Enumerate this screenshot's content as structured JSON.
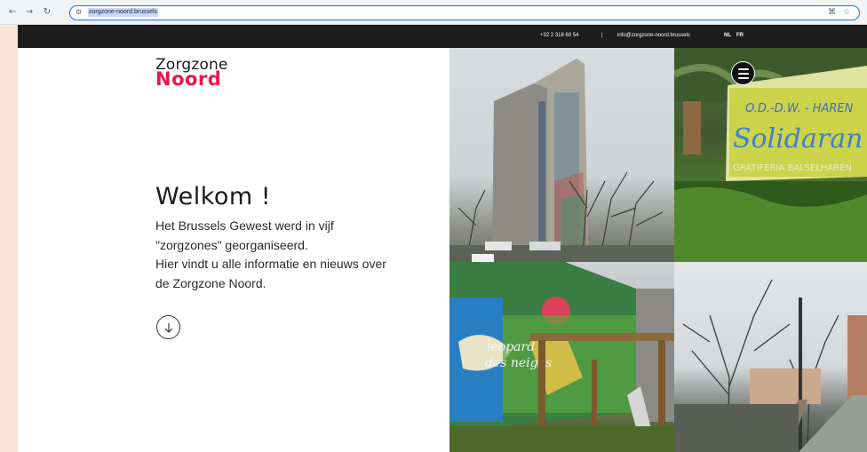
{
  "browser": {
    "url": "zorgzone-noord.brussels",
    "back_icon": "arrow-left-icon",
    "forward_icon": "arrow-right-icon",
    "reload_icon": "reload-icon",
    "site_info_icon": "tune-icon",
    "translate_icon": "translate-icon",
    "bookmark_icon": "star-icon"
  },
  "topbar": {
    "phone": "+32 2 318 60 54",
    "separator": "|",
    "email": "info@zorgzone-noord.brussels",
    "languages": [
      "NL",
      "FR"
    ]
  },
  "logo": {
    "line1": "Zorgzone",
    "line2": "Noord",
    "accent": "#e8174a"
  },
  "hero": {
    "title": "Welkom !",
    "text_lines": [
      "Het Brussels Gewest werd in vijf",
      "\"zorgzones\" georganiseerd.",
      "Hier vindt u alle informatie en nieuws over",
      "de Zorgzone Noord."
    ],
    "scroll_icon": "arrow-down-circle-icon"
  },
  "photos": {
    "sign_text_1": "O.D.-D.W. - HAREN",
    "sign_text_2": "Solidaran",
    "sign_text_3": "GRATIFERIA BALSELHAREN",
    "mural_text_1": "léopard",
    "mural_text_2": "des neiges"
  },
  "menu": {
    "icon": "hamburger-menu-icon"
  }
}
